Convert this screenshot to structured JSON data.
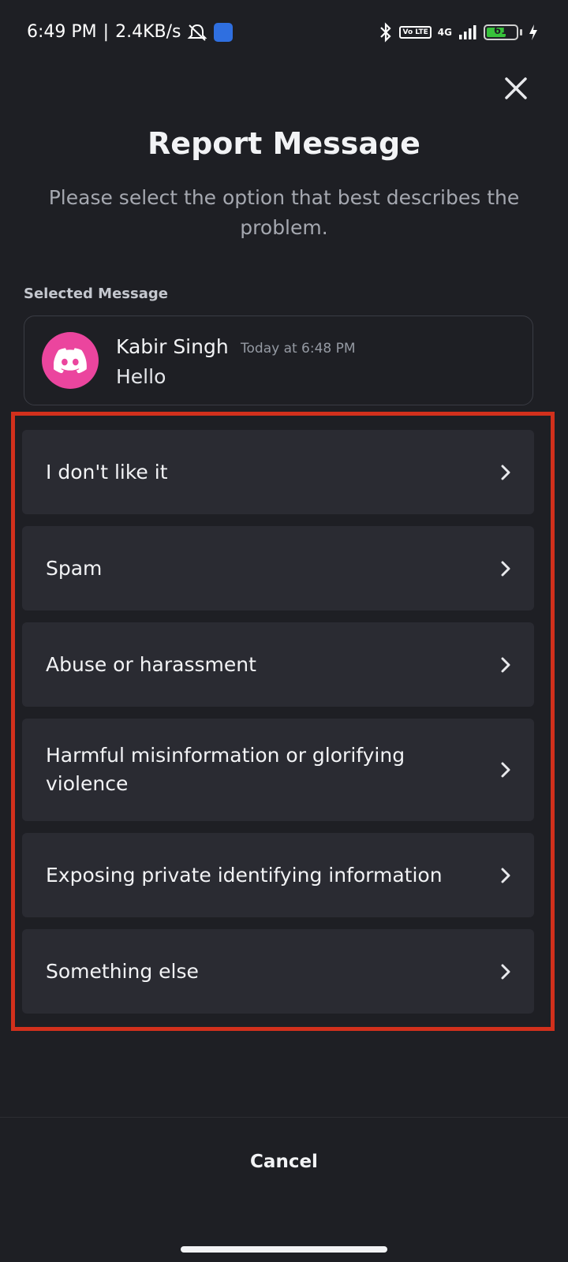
{
  "status_bar": {
    "time": "6:49 PM",
    "separator": "|",
    "speed": "2.4KB/s",
    "network": "4G",
    "volte": "Vo LTE",
    "battery": "61"
  },
  "dialog": {
    "title": "Report Message",
    "subtitle": "Please select the option that best describes the problem.",
    "selected_label": "Selected Message"
  },
  "message": {
    "author": "Kabir Singh",
    "time": "Today at 6:48 PM",
    "text": "Hello"
  },
  "options": [
    {
      "label": "I don't like it"
    },
    {
      "label": "Spam"
    },
    {
      "label": "Abuse or harassment"
    },
    {
      "label": "Harmful misinformation or glorifying violence"
    },
    {
      "label": "Exposing private identifying information"
    },
    {
      "label": "Something else"
    }
  ],
  "footer": {
    "cancel_label": "Cancel"
  },
  "colors": {
    "background": "#1e1f24",
    "option_bg": "#2a2b32",
    "avatar": "#eb459e",
    "highlight": "#d2301c"
  },
  "icons": {
    "close": "close-icon",
    "chevron": "chevron-right-icon",
    "avatar": "discord-logo-icon"
  }
}
